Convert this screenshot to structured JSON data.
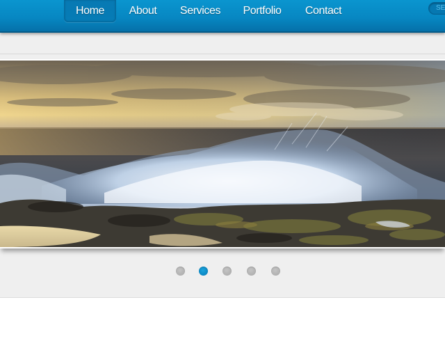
{
  "nav": {
    "items": [
      {
        "label": "Home",
        "active": true
      },
      {
        "label": "About",
        "active": false
      },
      {
        "label": "Services",
        "active": false
      },
      {
        "label": "Portfolio",
        "active": false
      },
      {
        "label": "Contact",
        "active": false
      }
    ],
    "search_placeholder": "SE"
  },
  "slider": {
    "image_subject": "ocean wave crashing on rocky shore at sunset",
    "active_slide": 2,
    "slide_count": 5
  },
  "colors": {
    "nav_blue": "#0787c2",
    "active_dot": "#0a86c2",
    "inactive_dot": "#b0b0b0",
    "panel_bg": "#efefef"
  }
}
